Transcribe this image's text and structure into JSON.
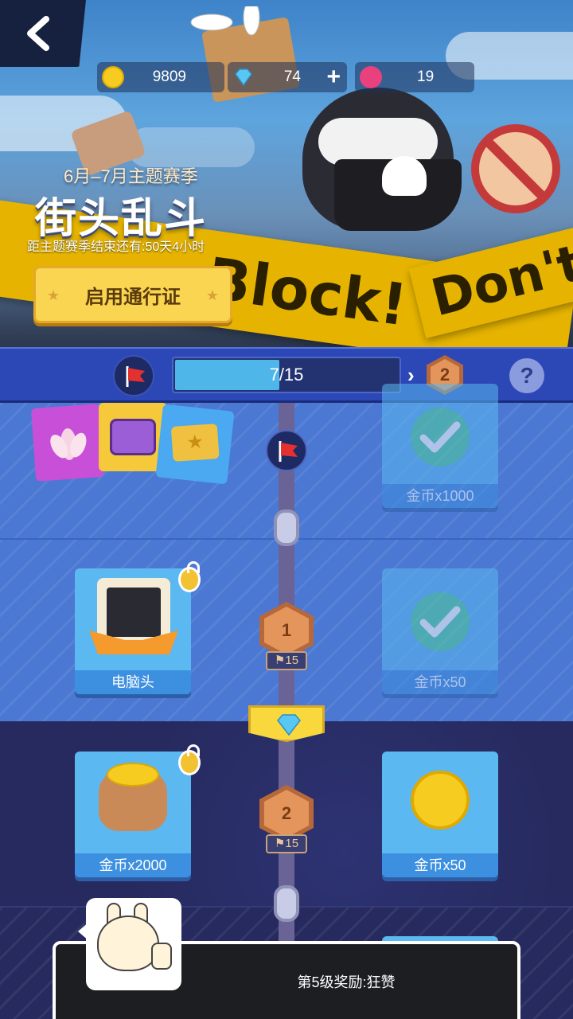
{
  "header": {
    "back_icon": "chevron-left-icon",
    "currency": {
      "coins": "9809",
      "gems": "74",
      "gem_plus": "+",
      "lotus": "19"
    }
  },
  "banner": {
    "season_subtitle": "6月–7月主题赛季",
    "season_title": "街头乱斗",
    "remaining": "距主题赛季结束还有:50天4小时",
    "pass_button": "启用通行证",
    "tape_text_1": "Block!",
    "tape_text_2": "Don't B"
  },
  "progress": {
    "text": "7/15",
    "fraction": 0.4667,
    "next_level": "2",
    "help": "?"
  },
  "rewards": {
    "row1": {
      "right_label": "金币x1000"
    },
    "row2": {
      "left_label": "电脑头",
      "right_label": "金币x50",
      "level": "1",
      "flags": "15"
    },
    "row3": {
      "left_label": "金币x2000",
      "right_label": "金币x50",
      "level": "2",
      "flags": "15"
    }
  },
  "toast": {
    "message": "第5级奖励:狂赞"
  },
  "colors": {
    "accent_yellow": "#f9d551",
    "bar_blue": "#2c48b6",
    "fill_blue": "#4fb6ea"
  }
}
